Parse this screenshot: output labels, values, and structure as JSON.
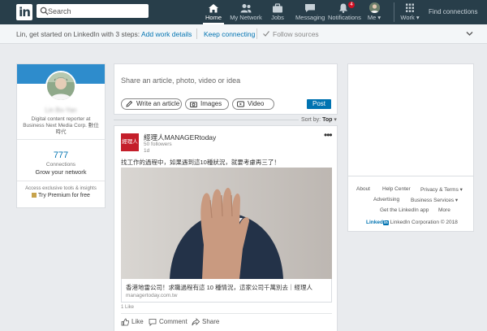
{
  "colors": {
    "nav_bg": "#283e4a",
    "accent": "#0073b1",
    "banner": "#2e8ccc",
    "page_bg": "#e9ebee",
    "badge": "#d11124"
  },
  "nav": {
    "logo_text": "in",
    "search_placeholder": "Search",
    "items": [
      {
        "label": "Home",
        "icon": "home-icon",
        "active": true
      },
      {
        "label": "My Network",
        "icon": "network-icon"
      },
      {
        "label": "Jobs",
        "icon": "briefcase-icon"
      },
      {
        "label": "Messaging",
        "icon": "messaging-icon"
      },
      {
        "label": "Notifications",
        "icon": "bell-icon",
        "badge": "4"
      },
      {
        "label": "Me",
        "icon": "avatar-icon"
      },
      {
        "label": "Work",
        "icon": "grid-icon"
      }
    ],
    "find_connections": "Find connections"
  },
  "onboarding": {
    "intro": "Lin, get started on LinkedIn with 3 steps:",
    "steps": [
      "Add work details",
      "Keep connecting",
      "Follow sources"
    ]
  },
  "profile": {
    "name": "Lin Bo-Yan",
    "headline": "Digital content reporter at Business Next Media Corp. 數位時代",
    "connections_count": "777",
    "connections_label": "Connections",
    "grow_text": "Grow your network",
    "exclusive_text": "Access exclusive tools & insights",
    "premium_text": "Try Premium for free"
  },
  "share": {
    "prompt": "Share an article, photo, video or idea",
    "write_article": "Write an article",
    "images": "Images",
    "video": "Video",
    "post": "Post"
  },
  "sort": {
    "label": "Sort by:",
    "value": "Top"
  },
  "post": {
    "company_logo_text": "經理人",
    "company": "經理人MANAGERtoday",
    "followers": "50 followers",
    "age": "1d",
    "menu": "•••",
    "text": "找工作的過程中，如果遇到這10種狀況，就要考慮再三了！",
    "link_title": "香港地雷公司！求職過程有這 10 種情況，這家公司千萬別去｜經理人",
    "link_domain": "managertoday.com.tw",
    "likes": "1 Like",
    "actions": [
      "Like",
      "Comment",
      "Share"
    ]
  },
  "footer": {
    "row1": [
      "About",
      "Help Center",
      "Privacy & Terms"
    ],
    "row2": [
      "Advertising",
      "Business Services"
    ],
    "row3": [
      "Get the LinkedIn app",
      "More"
    ],
    "copyright_logo": "Linked",
    "copyright": "LinkedIn Corporation © 2018"
  }
}
